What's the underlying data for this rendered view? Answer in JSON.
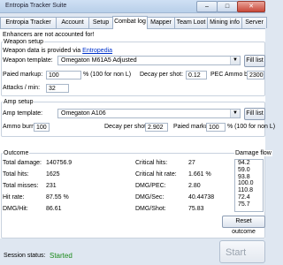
{
  "window": {
    "title": "Entropia Tracker Suite",
    "buttons": {
      "minimize": "–",
      "maximize": "□",
      "close": "✕"
    }
  },
  "tabs": [
    {
      "label": "Entropia Tracker"
    },
    {
      "label": "Account"
    },
    {
      "label": "Setup"
    },
    {
      "label": "Combat log"
    },
    {
      "label": "Mapper"
    },
    {
      "label": "Team Loot"
    },
    {
      "label": "Mining info"
    },
    {
      "label": "Server"
    }
  ],
  "combat_log": {
    "warning": "Enhancers are not accounted for!",
    "weapon_setup": {
      "header": "Weapon setup",
      "provider_text": "Weapon data is provided via",
      "provider_link": "Entropedia",
      "template_label": "Weapon template:",
      "template_value": "Omegaton M61A5 Adjusted",
      "fill_list": "Fill list",
      "paied_markup_label": "Paied markup:",
      "paied_markup_value": "100",
      "markup_hint": "% (100 for non L)",
      "decay_label": "Decay per shot:",
      "decay_value": "0.12",
      "decay_unit": "PEC",
      "ammo_burn_label": "Ammo burn:",
      "ammo_burn_value": "2300",
      "attacks_label": "Attacks / min:",
      "attacks_value": "32"
    },
    "amp_setup": {
      "header": "Amp setup",
      "template_label": "Amp template:",
      "template_value": "Omegaton A106",
      "fill_list": "Fill list",
      "ammo_burn_label": "Ammo burn:",
      "ammo_burn_value": "100",
      "decay_label": "Decay per shot:",
      "decay_value": "2.902",
      "paied_markup_label": "Paied markup:",
      "paied_markup_value": "100",
      "markup_hint": "% (100 for non L)"
    },
    "outcome": {
      "header": "Outcome",
      "left": [
        {
          "label": "Total damage:",
          "value": "140756.9"
        },
        {
          "label": "Total hits:",
          "value": "1625"
        },
        {
          "label": "Total misses:",
          "value": "231"
        },
        {
          "label": "Hit rate:",
          "value": "87.55 %"
        },
        {
          "label": "DMG/Hit:",
          "value": "86.61"
        }
      ],
      "right": [
        {
          "label": "Critical hits:",
          "value": "27"
        },
        {
          "label": "Critical hit rate:",
          "value": "1.661 %"
        },
        {
          "label": "DMG/PEC:",
          "value": "2.80"
        },
        {
          "label": "DMG/Sec:",
          "value": "40.44738"
        },
        {
          "label": "DMG/Shot:",
          "value": "75.83"
        }
      ],
      "damage_flow_label": "Damage flow",
      "damage_flow": [
        "94.2",
        "59.0",
        "93.8",
        "100.0",
        "110.8",
        "72.4",
        "75.7"
      ],
      "reset_button": "Reset outcome"
    }
  },
  "status": {
    "label": "Session status:",
    "value": "Started",
    "start_button": "Start logging"
  }
}
